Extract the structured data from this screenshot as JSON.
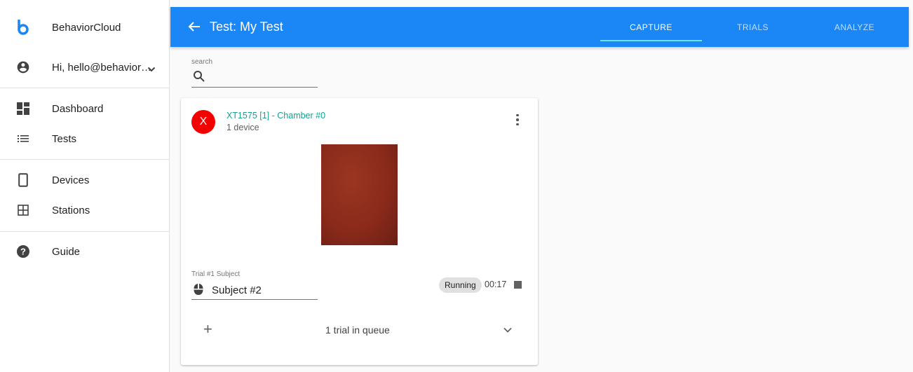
{
  "sidebar": {
    "brand": {
      "label": "BehaviorCloud",
      "color": "#1b86f5"
    },
    "account": {
      "label": "Hi, hello@behavior…",
      "icon": "account-circle-icon"
    },
    "items": [
      {
        "label": "Dashboard",
        "icon": "dashboard-icon"
      },
      {
        "label": "Tests",
        "icon": "list-icon"
      },
      {
        "label": "Devices",
        "icon": "phone-device-icon"
      },
      {
        "label": "Stations",
        "icon": "grid-icon"
      },
      {
        "label": "Guide",
        "icon": "help-circle-icon"
      }
    ]
  },
  "appbar": {
    "title": "Test: My Test",
    "color": "#1b86f5",
    "tabs": [
      {
        "label": "CAPTURE",
        "active": true
      },
      {
        "label": "TRIALS",
        "active": false
      },
      {
        "label": "ANALYZE",
        "active": false
      }
    ]
  },
  "search": {
    "label": "search",
    "value": ""
  },
  "card": {
    "avatar": "X",
    "avatar_color": "#f40000",
    "title": "XT1575 [1] - Chamber #0",
    "subtitle": "1 device",
    "trial_label": "Trial #1 Subject",
    "subject": "Subject #2",
    "status": "Running",
    "timer": "00:17",
    "add": "+",
    "queue": "1 trial in queue"
  }
}
